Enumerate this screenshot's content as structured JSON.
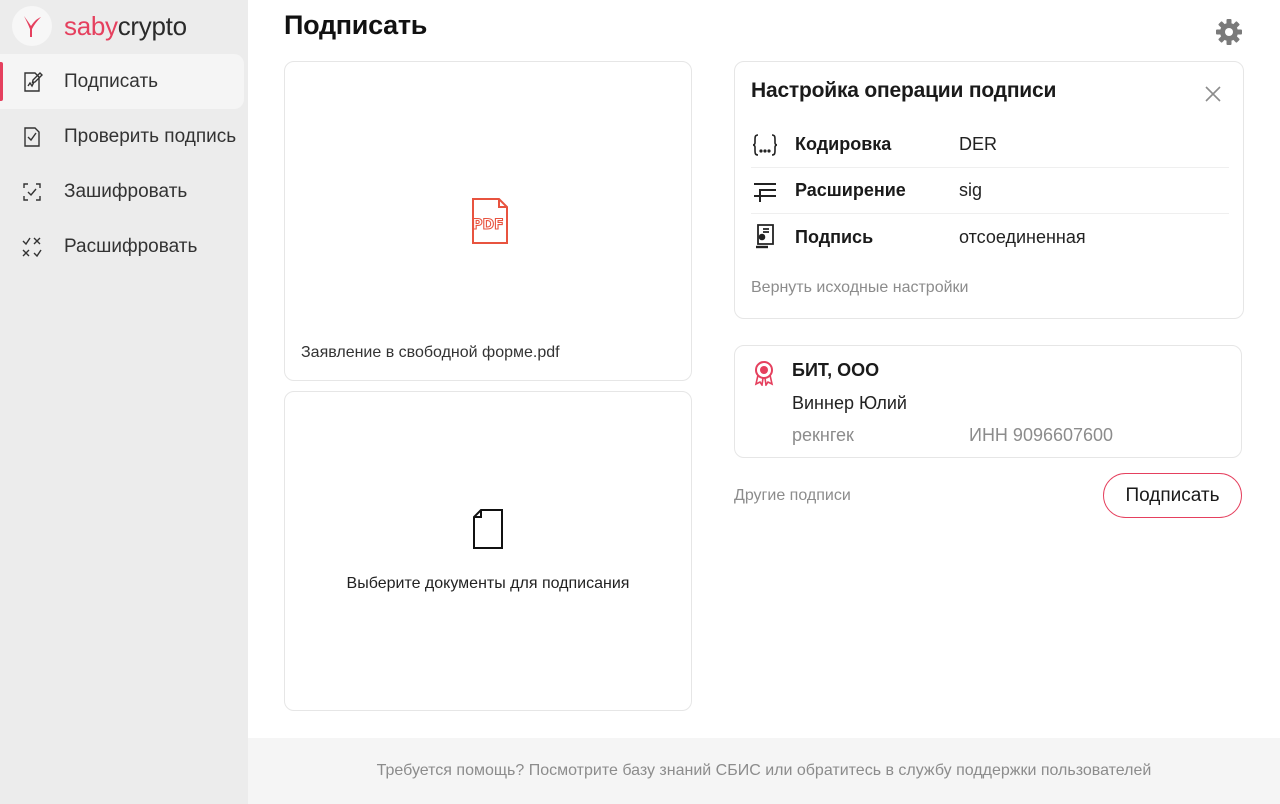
{
  "app": {
    "logo_primary": "saby",
    "logo_secondary": "crypto",
    "brand_color": "#e5405e"
  },
  "sidebar": {
    "items": [
      {
        "label": "Подписать",
        "icon": "sign-document-icon",
        "active": true
      },
      {
        "label": "Проверить подпись",
        "icon": "verify-signature-icon",
        "active": false
      },
      {
        "label": "Зашифровать",
        "icon": "encrypt-icon",
        "active": false
      },
      {
        "label": "Расшифровать",
        "icon": "decrypt-icon",
        "active": false
      }
    ]
  },
  "header": {
    "title": "Подписать",
    "settings_icon": "gear-icon"
  },
  "documents": {
    "selected_file": {
      "name": "Заявление в свободной форме.pdf",
      "icon": "pdf-file-icon",
      "icon_text": "PDF"
    },
    "drop_zone": {
      "text": "Выберите документы для подписания",
      "icon": "blank-document-icon"
    }
  },
  "settings_panel": {
    "title": "Настройка операции подписи",
    "close_icon": "close-icon",
    "rows": [
      {
        "label": "Кодировка",
        "value": "DER",
        "icon": "encoding-brackets-icon"
      },
      {
        "label": "Расширение",
        "value": "sig",
        "icon": "extension-lines-icon"
      },
      {
        "label": "Подпись",
        "value": "отсоединенная",
        "icon": "signature-type-icon"
      }
    ],
    "reset_label": "Вернуть исходные настройки"
  },
  "certificate": {
    "organization": "БИТ, ООО",
    "person": "Виннер Юлий",
    "issuer": "рекнгек",
    "inn": "ИНН 9096607600",
    "icon": "certificate-rosette-icon"
  },
  "actions": {
    "other_signatures_label": "Другие подписи",
    "sign_button_label": "Подписать"
  },
  "footer": {
    "help_text": "Требуется помощь? Посмотрите базу знаний СБИС или обратитесь в службу поддержки пользователей"
  }
}
